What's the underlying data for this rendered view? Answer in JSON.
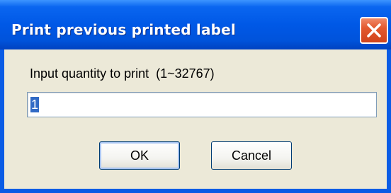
{
  "window": {
    "title": "Print previous printed label",
    "close_icon": "close-icon"
  },
  "dialog": {
    "prompt": "Input quantity to print  (1~32767)",
    "quantity_value": "1",
    "ok_label": "OK",
    "cancel_label": "Cancel"
  },
  "colors": {
    "titlebar": "#0058e6",
    "close_button": "#e3592f",
    "dialog_background": "#ece9d8",
    "selection": "#316ac5"
  }
}
